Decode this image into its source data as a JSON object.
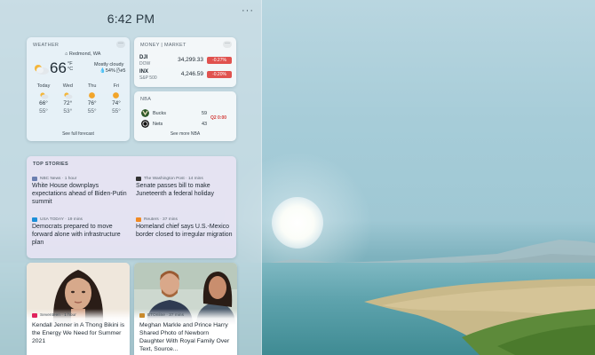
{
  "clock": {
    "time": "6:42 PM"
  },
  "panel": {
    "more_label": "···"
  },
  "weather": {
    "header": "WEATHER",
    "location": "Redmond, WA",
    "temp": "66",
    "units_f": "°F",
    "units_c": "°C",
    "condition": "Mostly cloudy",
    "humidity": "💧54%",
    "wind": "🌬5",
    "forecast": [
      {
        "day": "Today",
        "hi": "66°",
        "lo": "55°",
        "icon": "cloud-sun"
      },
      {
        "day": "Wed",
        "hi": "72°",
        "lo": "53°",
        "icon": "cloud-sun"
      },
      {
        "day": "Thu",
        "hi": "76°",
        "lo": "55°",
        "icon": "sun"
      },
      {
        "day": "Fri",
        "hi": "74°",
        "lo": "55°",
        "icon": "sun"
      }
    ],
    "link": "See full forecast"
  },
  "money": {
    "header": "MONEY | MARKET",
    "rows": [
      {
        "symbol": "DJI",
        "name": "DOW",
        "value": "34,299.33",
        "change": "-0.27%"
      },
      {
        "symbol": "INX",
        "name": "S&P 500",
        "value": "4,246.59",
        "change": "-0.20%"
      }
    ],
    "colors": {
      "negative": "#e0524f"
    }
  },
  "nba": {
    "header": "NBA",
    "teams": [
      {
        "name": "Bucks",
        "score": "59"
      },
      {
        "name": "Nets",
        "score": "43"
      }
    ],
    "status": "Q2 0:00",
    "link": "See more NBA"
  },
  "top_stories": {
    "header": "TOP STORIES",
    "items": [
      {
        "source": "NBC News · 1 hour",
        "title": "White House downplays expectations ahead of Biden-Putin summit"
      },
      {
        "source": "The Washington Post · 14 mins",
        "title": "Senate passes bill to make Juneteenth a federal holiday"
      },
      {
        "source": "USA TODAY · 19 mins",
        "title": "Democrats prepared to move forward alone with infrastructure plan"
      },
      {
        "source": "Reuters · 37 mins",
        "title": "Homeland chief says U.S.-Mexico border closed to irregular migration"
      }
    ]
  },
  "photo_cards": [
    {
      "source": "Seventeen · 1 hour",
      "title": "Kendall Jenner in A Thong Bikini is the Energy We Need for Summer 2021"
    },
    {
      "source": "ETOnline · 37 mins",
      "title": "Meghan Markle and Prince Harry Shared Photo of Newborn Daughter With Royal Family Over Text, Source..."
    }
  ]
}
